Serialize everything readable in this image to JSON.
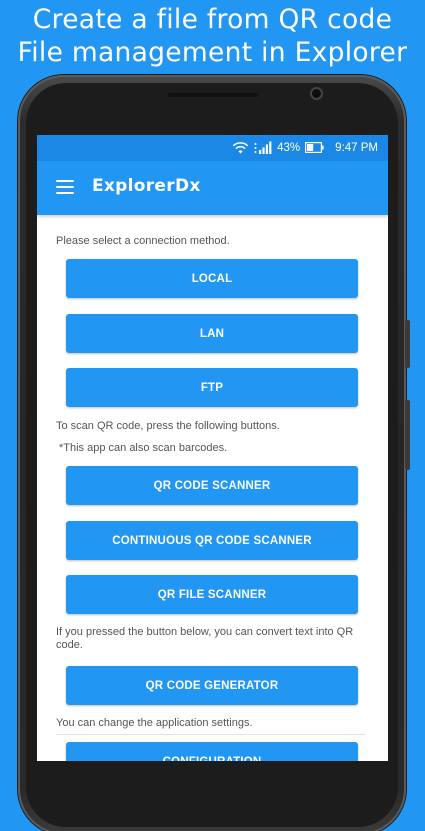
{
  "headline": {
    "line1": "Create a file from QR code",
    "line2": "File management in Explorer"
  },
  "status_bar": {
    "battery": "43%",
    "time": "9:47 PM"
  },
  "app_bar": {
    "title": "ExplorerDx"
  },
  "main": {
    "connection_label": "Please select a connection method.",
    "connection_buttons": [
      "LOCAL",
      "LAN",
      "FTP"
    ],
    "scan_label": "To scan QR code, press the following buttons.",
    "scan_note": "*This app can also scan barcodes.",
    "scan_buttons": [
      "QR CODE SCANNER",
      "CONTINUOUS QR CODE SCANNER",
      "QR FILE SCANNER"
    ],
    "generate_label": "If you pressed the button below, you can convert text into QR code.",
    "generate_button": "QR CODE GENERATOR",
    "settings_label": "You can change the application settings.",
    "settings_button": "CONFIGURATION"
  },
  "colors": {
    "background": "#2196f3",
    "status_bar": "#1b88e5",
    "button": "#2196f3",
    "label_text": "#555555"
  },
  "icons": [
    "wifi-icon",
    "signal-icon",
    "battery-icon",
    "menu-icon"
  ]
}
